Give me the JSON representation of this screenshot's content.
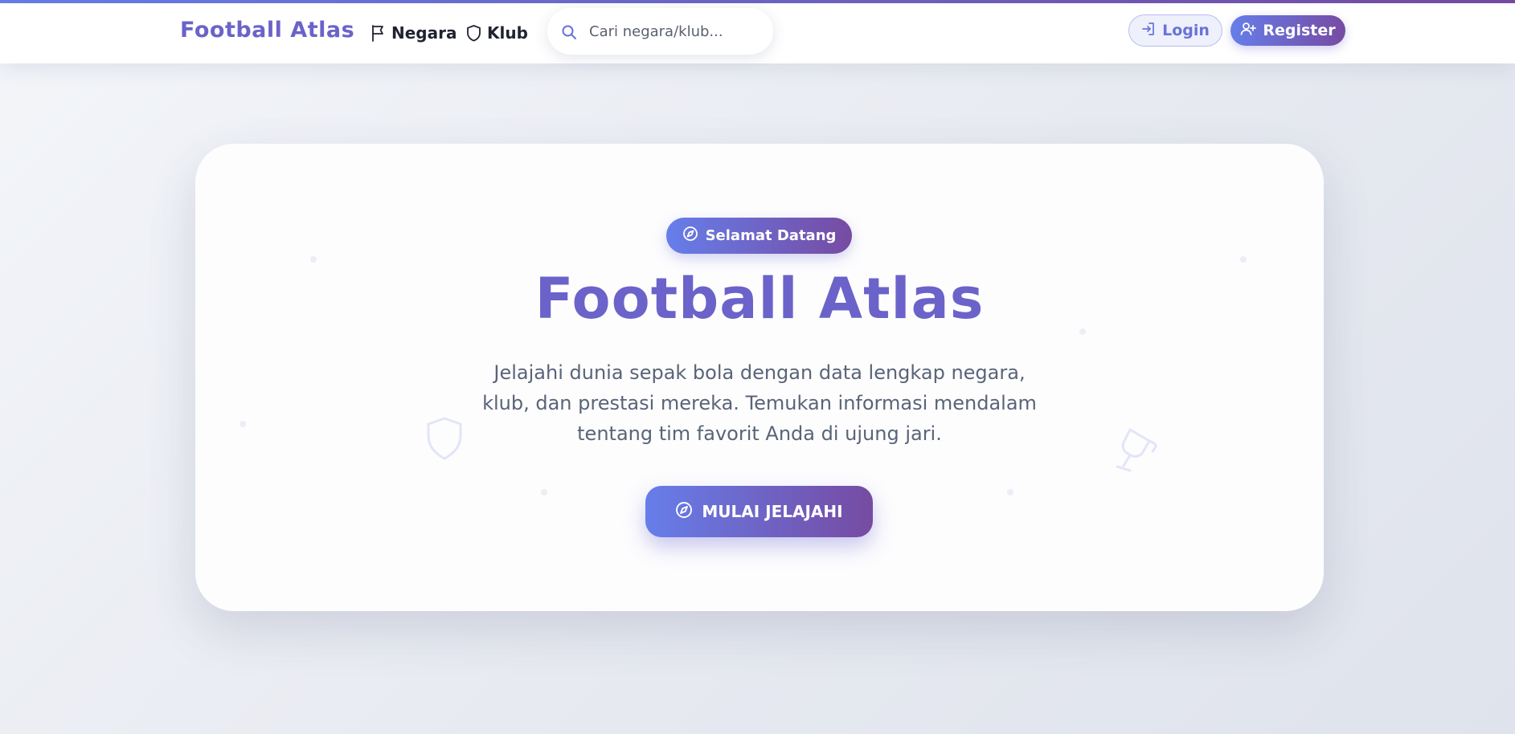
{
  "colors": {
    "accent_start": "#667eea",
    "accent_end": "#764ba2",
    "brand_text": "#6b63c9"
  },
  "navbar": {
    "brand": "Football Atlas",
    "links": [
      {
        "label": "Negara",
        "icon": "flag-icon"
      },
      {
        "label": "Klub",
        "icon": "shield-icon"
      }
    ],
    "search": {
      "placeholder": "Cari negara/klub...",
      "value": "",
      "icon": "search-icon"
    },
    "login_label": "Login",
    "register_label": "Register"
  },
  "hero": {
    "badge_label": "Selamat Datang",
    "title": "Football Atlas",
    "description": "Jelajahi dunia sepak bola dengan data lengkap negara, klub, dan prestasi mereka. Temukan informasi mendalam tentang tim favorit Anda di ujung jari.",
    "cta_label": "MULAI JELAJAHI",
    "decorations": [
      "shield-icon",
      "trophy-icon"
    ]
  }
}
